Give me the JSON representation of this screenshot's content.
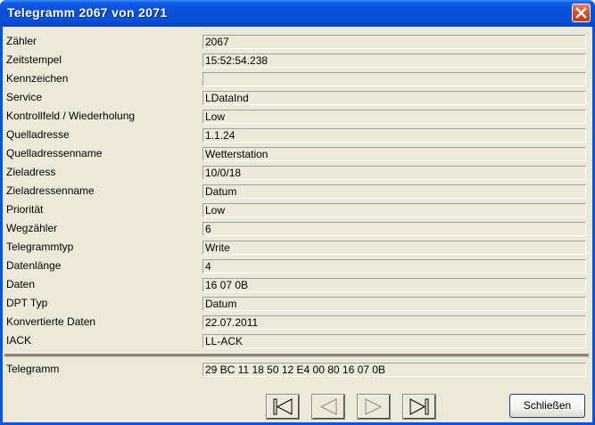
{
  "window": {
    "title": "Telegramm 2067 von 2071"
  },
  "fields": [
    {
      "label": "Zähler",
      "value": "2067"
    },
    {
      "label": "Zeitstempel",
      "value": "15:52:54.238"
    },
    {
      "label": "Kennzeichen",
      "value": ""
    },
    {
      "label": "Service",
      "value": "LDataInd"
    },
    {
      "label": "Kontrollfeld / Wiederholung",
      "value": "Low"
    },
    {
      "label": "Quelladresse",
      "value": "1.1.24"
    },
    {
      "label": "Quelladressenname",
      "value": "Wetterstation"
    },
    {
      "label": "Zieladress",
      "value": "10/0/18"
    },
    {
      "label": "Zieladressenname",
      "value": "Datum"
    },
    {
      "label": "Priorität",
      "value": "Low"
    },
    {
      "label": "Wegzähler",
      "value": "6"
    },
    {
      "label": "Telegrammtyp",
      "value": "Write"
    },
    {
      "label": "Datenlänge",
      "value": "4"
    },
    {
      "label": "Daten",
      "value": "16 07 0B"
    },
    {
      "label": "DPT Typ",
      "value": "Datum"
    },
    {
      "label": "Konvertierte Daten",
      "value": "22.07.2011"
    },
    {
      "label": "IACK",
      "value": "LL-ACK"
    }
  ],
  "telegram": {
    "label": "Telegramm",
    "value": "29 BC 11 18 50 12 E4 00 80 16 07 0B"
  },
  "buttons": {
    "close_label": "Schließen"
  },
  "icons": {
    "close": "close-icon",
    "first": "first-icon",
    "prev": "previous-icon",
    "next": "next-icon",
    "last": "last-icon"
  },
  "colors": {
    "titlebar": "#0a4fd8",
    "dialog_bg": "#ece9d8",
    "close_red": "#d8502c"
  }
}
